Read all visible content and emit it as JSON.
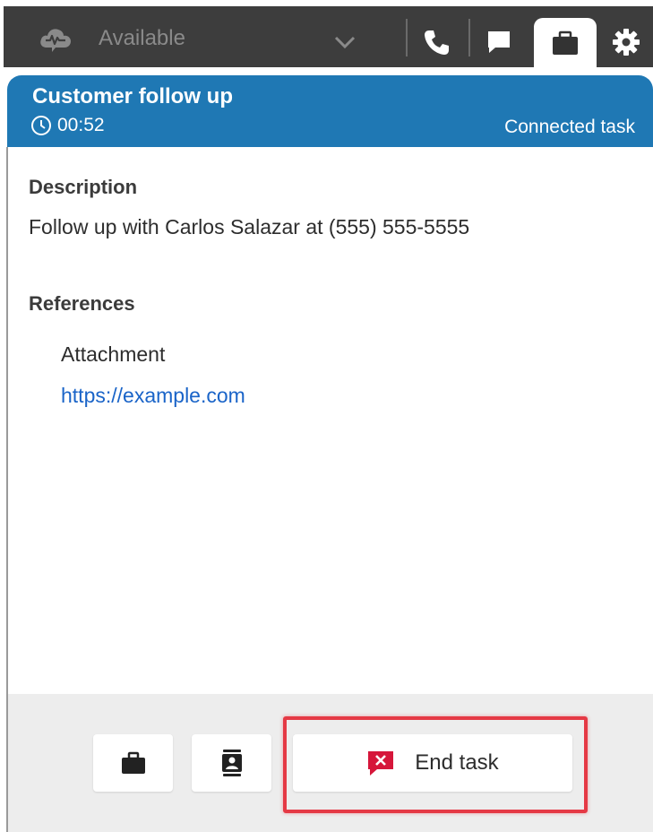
{
  "topbar": {
    "status_label": "Available",
    "icons": [
      "cloud-wave-icon",
      "chevron-down-icon",
      "phone-icon",
      "chat-icon",
      "briefcase-icon",
      "gear-icon"
    ]
  },
  "task": {
    "title": "Customer follow up",
    "timer": "00:52",
    "state": "Connected task"
  },
  "description": {
    "heading": "Description",
    "text": "Follow up with Carlos Salazar at (555) 555-5555"
  },
  "references": {
    "heading": "References",
    "label": "Attachment",
    "link": "https://example.com"
  },
  "footer": {
    "end_label": "End task",
    "icons": [
      "briefcase-icon",
      "contact-card-icon",
      "end-task-icon"
    ]
  },
  "colors": {
    "header_blue": "#1f78b4",
    "topbar_bg": "#3d3d3d",
    "link": "#1a64c8",
    "highlight": "#e53945",
    "end_icon_red": "#d6163a"
  }
}
